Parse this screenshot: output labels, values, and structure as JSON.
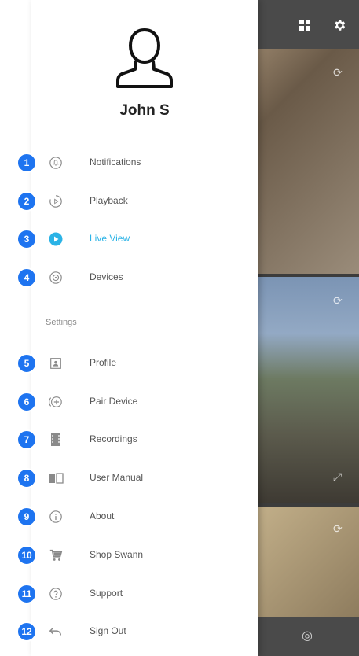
{
  "user": {
    "name": "John S"
  },
  "menu_primary": [
    {
      "label": "Notifications",
      "icon": "bell-icon",
      "badge": "1"
    },
    {
      "label": "Playback",
      "icon": "playback-icon",
      "badge": "2"
    },
    {
      "label": "Live View",
      "icon": "play-circle-icon",
      "badge": "3",
      "active": true
    },
    {
      "label": "Devices",
      "icon": "devices-icon",
      "badge": "4"
    }
  ],
  "settings_label": "Settings",
  "menu_settings": [
    {
      "label": "Profile",
      "icon": "profile-icon",
      "badge": "5"
    },
    {
      "label": "Pair Device",
      "icon": "pair-device-icon",
      "badge": "6"
    },
    {
      "label": "Recordings",
      "icon": "recordings-icon",
      "badge": "7"
    },
    {
      "label": "User Manual",
      "icon": "book-icon",
      "badge": "8"
    },
    {
      "label": "About",
      "icon": "info-icon",
      "badge": "9"
    },
    {
      "label": "Shop Swann",
      "icon": "cart-icon",
      "badge": "10"
    },
    {
      "label": "Support",
      "icon": "help-icon",
      "badge": "11"
    },
    {
      "label": "Sign Out",
      "icon": "sign-out-icon",
      "badge": "12"
    }
  ],
  "colors": {
    "accent": "#2bb3e6",
    "badge": "#1e74f0"
  }
}
